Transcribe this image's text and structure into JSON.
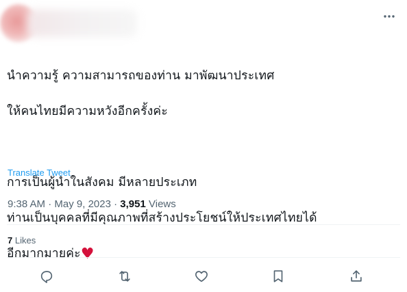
{
  "tweet": {
    "lines": [
      "นำความรู้ ความสามารถของท่าน มาพัฒนาประเทศ",
      "ให้คนไทยมีความหวังอีกครั้งค่ะ",
      "",
      "การเป็นผู้นำในสังคม มีหลายประเภท",
      "ท่านเป็นบุคคลที่มีคุณภาพที่สร้างประโยชน์ให้ประเทศไทยได้",
      "อีกมากมายค่ะ"
    ],
    "heart": "♥",
    "translate_label": "Translate Tweet"
  },
  "meta": {
    "time": "9:38 AM",
    "separator": "·",
    "date": "May 9, 2023",
    "views_count": "3,951",
    "views_label": "Views"
  },
  "engagement": {
    "likes_count": "7",
    "likes_label": "Likes"
  },
  "colors": {
    "accent": "#1d9bf0",
    "heart": "#d4113b",
    "secondary_text": "#536471",
    "primary_text": "#0f1419"
  },
  "icons": {
    "more": "more-dots-icon",
    "reply": "reply-icon",
    "retweet": "retweet-icon",
    "like": "heart-icon",
    "bookmark": "bookmark-icon",
    "share": "share-icon"
  }
}
